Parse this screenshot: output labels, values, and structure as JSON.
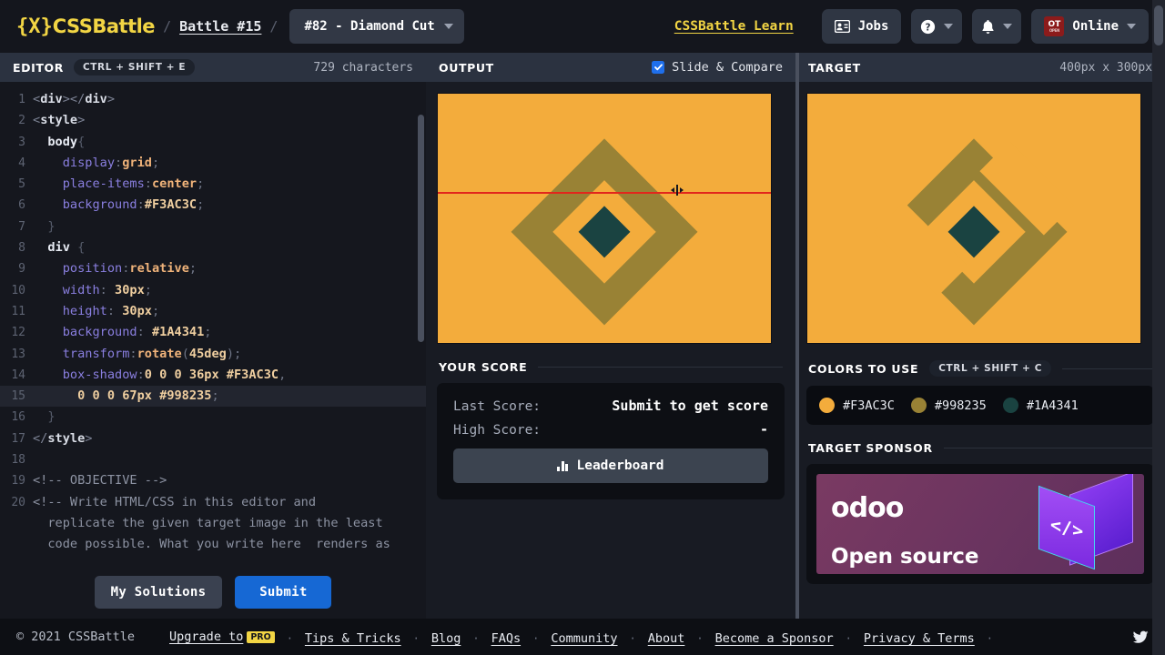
{
  "header": {
    "brand": "CSSBattle",
    "brand_mark": "{X}",
    "separator": "/",
    "breadcrumb": "Battle #15",
    "challenge_select": "#82 - Diamond Cut",
    "learn_link": "CSSBattle Learn",
    "jobs_button": "Jobs",
    "help_icon": "question-mark-icon",
    "bell_icon": "bell-icon",
    "account_badge": "OT",
    "account_badge_sub": "OPEN",
    "account_status": "Online"
  },
  "editor": {
    "title": "EDITOR",
    "shortcut": "CTRL + SHIFT + E",
    "char_count": "729 characters",
    "my_solutions_label": "My Solutions",
    "submit_label": "Submit",
    "active_line": 15,
    "lines": [
      {
        "n": "1",
        "tokens": [
          {
            "t": "<",
            "c": "t-angl"
          },
          {
            "t": "div",
            "c": "t-tag"
          },
          {
            "t": "></",
            "c": "t-angl"
          },
          {
            "t": "div",
            "c": "t-tag"
          },
          {
            "t": ">",
            "c": "t-angl"
          }
        ]
      },
      {
        "n": "2",
        "tokens": [
          {
            "t": "<",
            "c": "t-angl"
          },
          {
            "t": "style",
            "c": "t-tag"
          },
          {
            "t": ">",
            "c": "t-angl"
          }
        ]
      },
      {
        "n": "3",
        "tokens": [
          {
            "t": "  ",
            "c": "ct"
          },
          {
            "t": "body",
            "c": "t-sel"
          },
          {
            "t": "{",
            "c": "t-brace"
          }
        ]
      },
      {
        "n": "4",
        "tokens": [
          {
            "t": "    ",
            "c": "ct"
          },
          {
            "t": "display",
            "c": "t-prop"
          },
          {
            "t": ":",
            "c": "t-punc"
          },
          {
            "t": "grid",
            "c": "t-val"
          },
          {
            "t": ";",
            "c": "t-punc"
          }
        ]
      },
      {
        "n": "5",
        "tokens": [
          {
            "t": "    ",
            "c": "ct"
          },
          {
            "t": "place-items",
            "c": "t-prop"
          },
          {
            "t": ":",
            "c": "t-punc"
          },
          {
            "t": "center",
            "c": "t-val"
          },
          {
            "t": ";",
            "c": "t-punc"
          }
        ]
      },
      {
        "n": "6",
        "tokens": [
          {
            "t": "    ",
            "c": "ct"
          },
          {
            "t": "background",
            "c": "t-prop"
          },
          {
            "t": ":",
            "c": "t-punc"
          },
          {
            "t": "#F3AC3C",
            "c": "t-num"
          },
          {
            "t": ";",
            "c": "t-punc"
          }
        ]
      },
      {
        "n": "7",
        "tokens": [
          {
            "t": "  ",
            "c": "ct"
          },
          {
            "t": "}",
            "c": "t-brace"
          }
        ]
      },
      {
        "n": "8",
        "tokens": [
          {
            "t": "  ",
            "c": "ct"
          },
          {
            "t": "div",
            "c": "t-sel"
          },
          {
            "t": " {",
            "c": "t-brace"
          }
        ]
      },
      {
        "n": "9",
        "tokens": [
          {
            "t": "    ",
            "c": "ct"
          },
          {
            "t": "position",
            "c": "t-prop"
          },
          {
            "t": ":",
            "c": "t-punc"
          },
          {
            "t": "relative",
            "c": "t-val"
          },
          {
            "t": ";",
            "c": "t-punc"
          }
        ]
      },
      {
        "n": "10",
        "tokens": [
          {
            "t": "    ",
            "c": "ct"
          },
          {
            "t": "width",
            "c": "t-prop"
          },
          {
            "t": ": ",
            "c": "t-punc"
          },
          {
            "t": "30px",
            "c": "t-num"
          },
          {
            "t": ";",
            "c": "t-punc"
          }
        ]
      },
      {
        "n": "11",
        "tokens": [
          {
            "t": "    ",
            "c": "ct"
          },
          {
            "t": "height",
            "c": "t-prop"
          },
          {
            "t": ": ",
            "c": "t-punc"
          },
          {
            "t": "30px",
            "c": "t-num"
          },
          {
            "t": ";",
            "c": "t-punc"
          }
        ]
      },
      {
        "n": "12",
        "tokens": [
          {
            "t": "    ",
            "c": "ct"
          },
          {
            "t": "background",
            "c": "t-prop"
          },
          {
            "t": ": ",
            "c": "t-punc"
          },
          {
            "t": "#1A4341",
            "c": "t-num"
          },
          {
            "t": ";",
            "c": "t-punc"
          }
        ]
      },
      {
        "n": "13",
        "tokens": [
          {
            "t": "    ",
            "c": "ct"
          },
          {
            "t": "transform",
            "c": "t-prop"
          },
          {
            "t": ":",
            "c": "t-punc"
          },
          {
            "t": "rotate",
            "c": "t-val"
          },
          {
            "t": "(",
            "c": "t-punc"
          },
          {
            "t": "45deg",
            "c": "t-num"
          },
          {
            "t": ");",
            "c": "t-punc"
          }
        ]
      },
      {
        "n": "14",
        "tokens": [
          {
            "t": "    ",
            "c": "ct"
          },
          {
            "t": "box-shadow",
            "c": "t-prop"
          },
          {
            "t": ":",
            "c": "t-punc"
          },
          {
            "t": "0 0 0 36px #F3AC3C",
            "c": "t-num"
          },
          {
            "t": ",",
            "c": "t-punc"
          }
        ]
      },
      {
        "n": "15",
        "tokens": [
          {
            "t": "      ",
            "c": "ct"
          },
          {
            "t": "0 0 0 67px #998235",
            "c": "t-num"
          },
          {
            "t": ";",
            "c": "t-punc"
          }
        ]
      },
      {
        "n": "16",
        "tokens": [
          {
            "t": "  ",
            "c": "ct"
          },
          {
            "t": "}",
            "c": "t-brace"
          }
        ]
      },
      {
        "n": "17",
        "tokens": [
          {
            "t": "</",
            "c": "t-angl"
          },
          {
            "t": "style",
            "c": "t-tag"
          },
          {
            "t": ">",
            "c": "t-angl"
          }
        ]
      },
      {
        "n": "18",
        "tokens": []
      },
      {
        "n": "19",
        "tokens": [
          {
            "t": "<!-- OBJECTIVE -->",
            "c": "t-cmt"
          }
        ]
      },
      {
        "n": "20",
        "tokens": [
          {
            "t": "<!-- Write HTML/CSS in this editor and",
            "c": "t-cmt"
          }
        ]
      },
      {
        "n": "",
        "tokens": [
          {
            "t": "  replicate the given target image in the least",
            "c": "t-cmt"
          }
        ]
      },
      {
        "n": "",
        "tokens": [
          {
            "t": "  code possible. What you write here  renders as",
            "c": "t-cmt"
          }
        ]
      }
    ]
  },
  "output": {
    "title": "OUTPUT",
    "slide_compare_label": "Slide & Compare",
    "slide_compare_checked": true,
    "score_section_title": "YOUR SCORE",
    "last_score_label": "Last Score:",
    "last_score_value": "Submit to get score",
    "high_score_label": "High Score:",
    "high_score_value": "-",
    "leaderboard_label": "Leaderboard"
  },
  "target": {
    "title": "TARGET",
    "dimensions": "400px x 300px",
    "colors_title": "COLORS TO USE",
    "colors_shortcut": "CTRL + SHIFT + C",
    "colors": [
      {
        "hex": "#F3AC3C"
      },
      {
        "hex": "#998235"
      },
      {
        "hex": "#1A4341"
      }
    ],
    "sponsor_title": "TARGET SPONSOR",
    "sponsor_name": "odoo",
    "sponsor_tagline": "Open source"
  },
  "artwork": {
    "background": "#F3AC3C",
    "ring": "#998235",
    "center": "#1A4341"
  },
  "footer": {
    "copyright": "© 2021 CSSBattle",
    "upgrade_label": "Upgrade to",
    "pro_badge": "PRO",
    "links": [
      "Tips & Tricks",
      "Blog",
      "FAQs",
      "Community",
      "About",
      "Become a Sponsor",
      "Privacy & Terms"
    ],
    "dot": "·",
    "twitter_icon": "twitter-icon"
  }
}
